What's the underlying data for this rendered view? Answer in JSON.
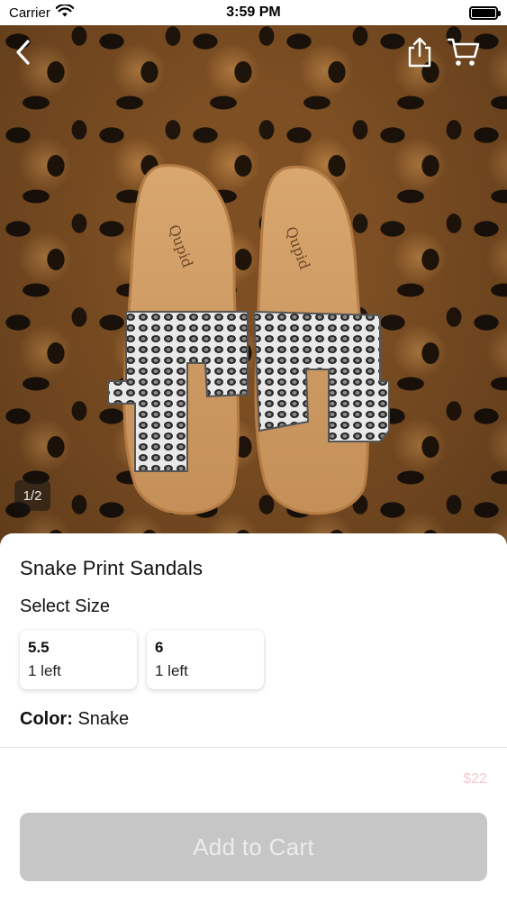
{
  "status_bar": {
    "carrier": "Carrier",
    "time": "3:59 PM"
  },
  "nav": {
    "back_icon": "chevron-left-icon",
    "share_icon": "share-icon",
    "cart_icon": "cart-icon"
  },
  "gallery": {
    "page_indicator": "1/2"
  },
  "product": {
    "title": "Snake Print Sandals",
    "select_size_label": "Select Size",
    "sizes": [
      {
        "size": "5.5",
        "stock": "1 left"
      },
      {
        "size": "6",
        "stock": "1 left"
      }
    ],
    "color_label": "Color:",
    "color_value": "Snake",
    "price": "$22"
  },
  "actions": {
    "add_to_cart_label": "Add to Cart"
  },
  "colors": {
    "button_disabled": "#c6c6c6",
    "price_text": "#f6c9cf"
  }
}
